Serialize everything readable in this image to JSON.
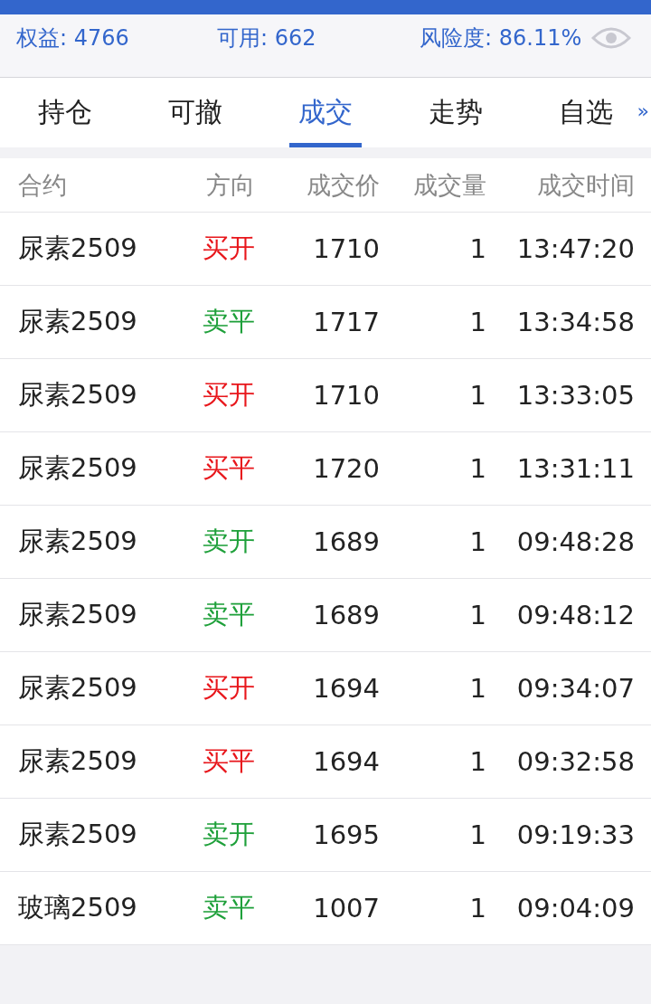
{
  "account": [
    "权益: 4766",
    "可用: 662",
    "风险度: 86.11%"
  ],
  "tabs": [
    {
      "label": "持仓",
      "selected": false
    },
    {
      "label": "可撤",
      "selected": false
    },
    {
      "label": "成交",
      "selected": true
    },
    {
      "label": "走势",
      "selected": false
    },
    {
      "label": "自选",
      "selected": false
    }
  ],
  "tabs_more": "»",
  "table": {
    "columns": [
      "合约",
      "方向",
      "成交价",
      "成交量",
      "成交时间"
    ],
    "rows": [
      {
        "contract": "尿素2509",
        "direction": "买开",
        "color": "#e8161b",
        "price": "1710",
        "volume": "1",
        "time": "13:47:20"
      },
      {
        "contract": "尿素2509",
        "direction": "卖平",
        "color": "#1ea03a",
        "price": "1717",
        "volume": "1",
        "time": "13:34:58"
      },
      {
        "contract": "尿素2509",
        "direction": "买开",
        "color": "#e8161b",
        "price": "1710",
        "volume": "1",
        "time": "13:33:05"
      },
      {
        "contract": "尿素2509",
        "direction": "买平",
        "color": "#e8161b",
        "price": "1720",
        "volume": "1",
        "time": "13:31:11"
      },
      {
        "contract": "尿素2509",
        "direction": "卖开",
        "color": "#1ea03a",
        "price": "1689",
        "volume": "1",
        "time": "09:48:28"
      },
      {
        "contract": "尿素2509",
        "direction": "卖平",
        "color": "#1ea03a",
        "price": "1689",
        "volume": "1",
        "time": "09:48:12"
      },
      {
        "contract": "尿素2509",
        "direction": "买开",
        "color": "#e8161b",
        "price": "1694",
        "volume": "1",
        "time": "09:34:07"
      },
      {
        "contract": "尿素2509",
        "direction": "买平",
        "color": "#e8161b",
        "price": "1694",
        "volume": "1",
        "time": "09:32:58"
      },
      {
        "contract": "尿素2509",
        "direction": "卖开",
        "color": "#1ea03a",
        "price": "1695",
        "volume": "1",
        "time": "09:19:33"
      },
      {
        "contract": "玻璃2509",
        "direction": "卖平",
        "color": "#1ea03a",
        "price": "1007",
        "volume": "1",
        "time": "09:04:09"
      }
    ]
  }
}
